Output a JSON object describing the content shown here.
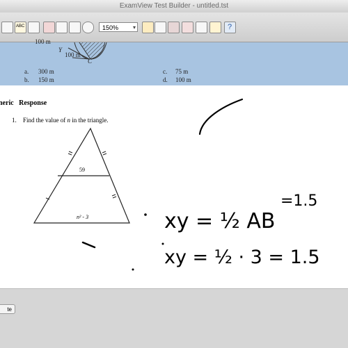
{
  "window": {
    "title": "ExamView Test Builder - untitled.tst"
  },
  "toolbar": {
    "zoom": "150%",
    "tools": [
      "new-icon",
      "open-icon",
      "spelling-icon",
      "print-icon",
      "save-icon",
      "list-icon",
      "insert-icon",
      "view-icon",
      "edit-icon",
      "question-icon",
      "answer-icon",
      "grade-icon",
      "check-icon",
      "help-icon"
    ]
  },
  "prev_question": {
    "figure_labels": {
      "len1": "100 m",
      "y": "Y",
      "len2": "100 m",
      "c": "C"
    },
    "options": [
      {
        "letter": "a.",
        "text": "300 m"
      },
      {
        "letter": "b.",
        "text": "150 m"
      },
      {
        "letter": "c.",
        "text": "75 m"
      },
      {
        "letter": "d.",
        "text": "100 m"
      }
    ]
  },
  "section": {
    "heading": "neric   Response"
  },
  "question": {
    "number": "1.",
    "text_pre": "Find the value of ",
    "variable": "n",
    "text_post": " in the triangle.",
    "mid_label": "59",
    "base_label": "n² - 3"
  },
  "handwriting": {
    "line1": "xy = ½ AB",
    "line1_suffix": "=1.5",
    "line2": "xy = ½ · 3 = 1.5",
    "ink_color": "#000000"
  },
  "bottom": {
    "button_label": "te"
  }
}
